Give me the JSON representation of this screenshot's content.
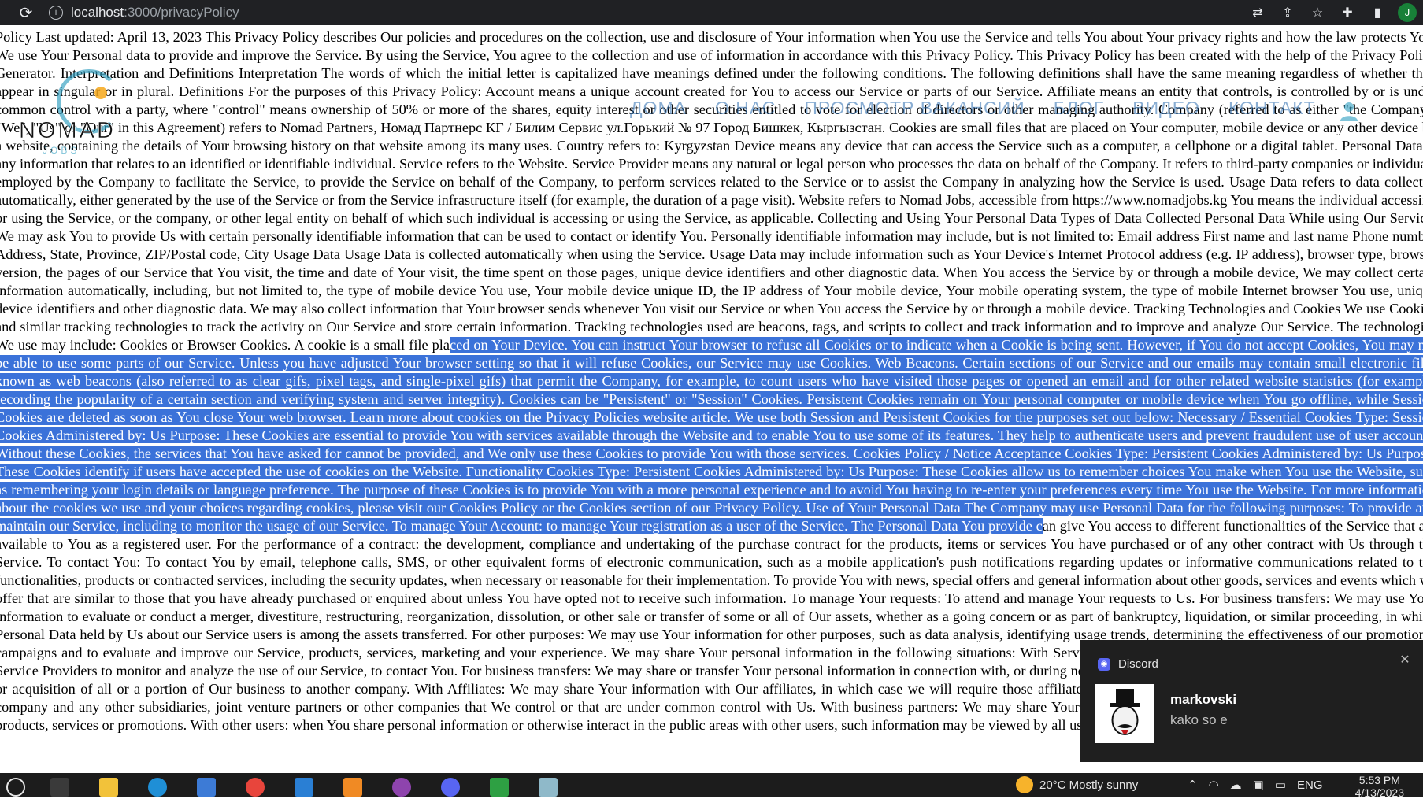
{
  "browser": {
    "url_host": "localhost",
    "url_path": ":3000/privacyPolicy",
    "profile_initial": "J"
  },
  "site": {
    "logo_text": "NOMAD",
    "logo_sub": "JOBS",
    "nav": [
      "ДОМА",
      "О НАС",
      "ПРОСМОТР ВАКАНСИЙ",
      "БЛОГ",
      "ВИДЕО",
      "КОНТАКТ"
    ]
  },
  "policy": {
    "before_selection": "Policy Last updated: April 13, 2023 This Privacy Policy describes Our policies and procedures on the collection, use and disclosure of Your information when You use the Service and tells You about Your privacy rights and how the law protects You. We use Your Personal data to provide and improve the Service. By using the Service, You agree to the collection and use of information in accordance with this Privacy Policy. This Privacy Policy has been created with the help of the Privacy Policy Generator. Interpretation and Definitions Interpretation The words of which the initial letter is capitalized have meanings defined under the following conditions. The following definitions shall have the same meaning regardless of whether they appear in singular or in plural. Definitions For the purposes of this Privacy Policy: Account means a unique account created for You to access our Service or parts of our Service. Affiliate means an entity that controls, is controlled by or is under common control with a party, where \"control\" means ownership of 50% or more of the shares, equity interest or other securities entitled to vote for election of directors or other managing authority. Company (referred to as either \"the Company\", \"We\", \"Us\" or \"Our\" in this Agreement) refers to Nomad Partners, Номад Партнерс КГ / Билим Сервис ул.Горький № 97 Город Бишкек, Кыргызстан. Cookies are small files that are placed on Your computer, mobile device or any other device by a website, containing the details of Your browsing history on that website among its many uses. Country refers to: Kyrgyzstan Device means any device that can access the Service such as a computer, a cellphone or a digital tablet. Personal Data is any information that relates to an identified or identifiable individual. Service refers to the Website. Service Provider means any natural or legal person who processes the data on behalf of the Company. It refers to third-party companies or individuals employed by the Company to facilitate the Service, to provide the Service on behalf of the Company, to perform services related to the Service or to assist the Company in analyzing how the Service is used. Usage Data refers to data collected automatically, either generated by the use of the Service or from the Service infrastructure itself (for example, the duration of a page visit). Website refers to Nomad Jobs, accessible from https://www.nomadjobs.kg You means the individual accessing or using the Service, or the company, or other legal entity on behalf of which such individual is accessing or using the Service, as applicable. Collecting and Using Your Personal Data Types of Data Collected Personal Data While using Our Service, We may ask You to provide Us with certain personally identifiable information that can be used to contact or identify You. Personally identifiable information may include, but is not limited to: Email address First name and last name Phone number Address, State, Province, ZIP/Postal code, City Usage Data Usage Data is collected automatically when using the Service. Usage Data may include information such as Your Device's Internet Protocol address (e.g. IP address), browser type, browser version, the pages of our Service that You visit, the time and date of Your visit, the time spent on those pages, unique device identifiers and other diagnostic data. When You access the Service by or through a mobile device, We may collect certain information automatically, including, but not limited to, the type of mobile device You use, Your mobile device unique ID, the IP address of Your mobile device, Your mobile operating system, the type of mobile Internet browser You use, unique device identifiers and other diagnostic data. We may also collect information that Your browser sends whenever You visit our Service or when You access the Service by or through a mobile device. Tracking Technologies and Cookies We use Cookies and similar tracking technologies to track the activity on Our Service and store certain information. Tracking technologies used are beacons, tags, and scripts to collect and track information and to improve and analyze Our Service. The technologies We use may include: Cookies or Browser Cookies. A cookie is a small file pla",
    "selected": "ced on Your Device. You can instruct Your browser to refuse all Cookies or to indicate when a Cookie is being sent. However, if You do not accept Cookies, You may not be able to use some parts of our Service. Unless you have adjusted Your browser setting so that it will refuse Cookies, our Service may use Cookies. Web Beacons. Certain sections of our Service and our emails may contain small electronic files known as web beacons (also referred to as clear gifs, pixel tags, and single-pixel gifs) that permit the Company, for example, to count users who have visited those pages or opened an email and for other related website statistics (for example, recording the popularity of a certain section and verifying system and server integrity). Cookies can be \"Persistent\" or \"Session\" Cookies. Persistent Cookies remain on Your personal computer or mobile device when You go offline, while Session Cookies are deleted as soon as You close Your web browser. Learn more about cookies on the Privacy Policies website article. We use both Session and Persistent Cookies for the purposes set out below: Necessary / Essential Cookies Type: Session Cookies Administered by: Us Purpose: These Cookies are essential to provide You with services available through the Website and to enable You to use some of its features. They help to authenticate users and prevent fraudulent use of user accounts. Without these Cookies, the services that You have asked for cannot be provided, and We only use these Cookies to provide You with those services. Cookies Policy / Notice Acceptance Cookies Type: Persistent Cookies Administered by: Us Purpose: These Cookies identify if users have accepted the use of cookies on the Website. Functionality Cookies Type: Persistent Cookies Administered by: Us Purpose: These Cookies allow us to remember choices You make when You use the Website, such as remembering your login details or language preference. The purpose of these Cookies is to provide You with a more personal experience and to avoid You having to re-enter your preferences every time You use the Website. For more information about the cookies we use and your choices regarding cookies, please visit our Cookies Policy or the Cookies section of our Privacy Policy. Use of Your Personal Data The Company may use Personal Data for the following purposes: To provide and maintain our Service, including to monitor the usage of our Service. To manage Your Account: to manage Your registration as a user of the Service. The Personal Data You provide c",
    "after_selection": "an give You access to different functionalities of the Service that are available to You as a registered user. For the performance of a contract: the development, compliance and undertaking of the purchase contract for the products, items or services You have purchased or of any other contract with Us through the Service. To contact You: To contact You by email, telephone calls, SMS, or other equivalent forms of electronic communication, such as a mobile application's push notifications regarding updates or informative communications related to the functionalities, products or contracted services, including the security updates, when necessary or reasonable for their implementation. To provide You with news, special offers and general information about other goods, services and events which we offer that are similar to those that you have already purchased or enquired about unless You have opted not to receive such information. To manage Your requests: To attend and manage Your requests to Us. For business transfers: We may use Your information to evaluate or conduct a merger, divestiture, restructuring, reorganization, dissolution, or other sale or transfer of some or all of Our assets, whether as a going concern or as part of bankruptcy, liquidation, or similar proceeding, in which Personal Data held by Us about our Service users is among the assets transferred. For other purposes: We may use Your information for other purposes, such as data analysis, identifying usage trends, determining the effectiveness of our promotional campaigns and to evaluate and improve our Service, products, services, marketing and your experience. We may share Your personal information in the following situations: With Service Providers: We may share Your personal information with Service Providers to monitor and analyze the use of our Service, to contact You. For business transfers: We may share or transfer Your personal information in connection with, or during negotiations of, any merger, sale of Company assets, financing, or acquisition of all or a portion of Our business to another company. With Affiliates: We may share Your information with Our affiliates, in which case we will require those affiliates to honor this Privacy Policy. Affiliates include Our parent company and any other subsidiaries, joint venture partners or other companies that We control or that are under common control with Us. With business partners: We may share Your information with Our business partners to offer You certain products, services or promotions. With other users: when You share personal information or otherwise interact in the public areas with other users, such information may be viewed by all users and may be publicly distributed outside."
  },
  "notification": {
    "app": "Discord",
    "sender": "markovski",
    "message": "kako so e"
  },
  "taskbar": {
    "weather": "20°C  Mostly sunny",
    "language": "ENG",
    "time": "5:53 PM",
    "date": "4/13/2023"
  },
  "colors": {
    "selection": "#3b72d9",
    "nav": "#2b6cb0",
    "logo_accent": "#2d9dc0",
    "logo_dot": "#f6a81b"
  }
}
